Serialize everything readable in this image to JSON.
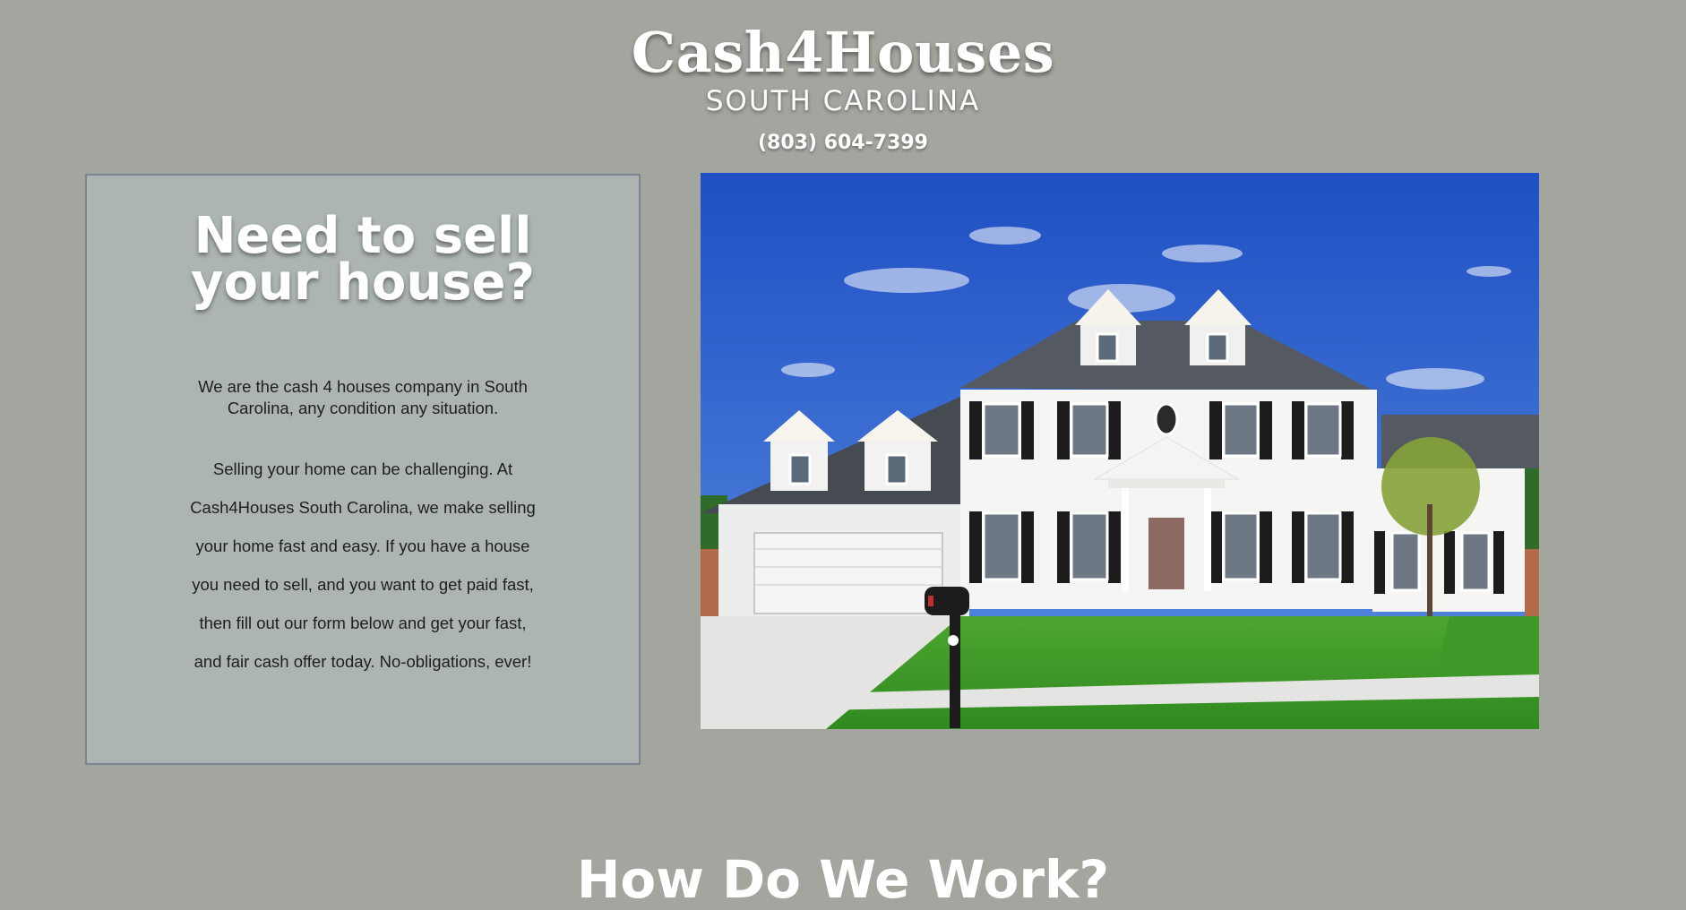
{
  "header": {
    "brand": "Cash4Houses",
    "region": "SOUTH CAROLINA",
    "phone": "(803) 604-7399"
  },
  "intro_panel": {
    "heading_line1": "Need to sell",
    "heading_line2": "your house?",
    "intro": "We are the cash 4 houses company in South Carolina, any condition any situation.",
    "body": "Selling your home can be challenging. At Cash4Houses South Carolina, we make selling your home fast and easy. If you have a house you need to sell, and you want to get paid fast, then fill out our form below and get your fast, and fair cash offer today. No-obligations, ever!"
  },
  "hero_image": {
    "alt": "white two-story colonial house with black shutters and green lawn"
  },
  "next_section": {
    "heading": "How Do We Work?"
  },
  "colors": {
    "page_background": "#a2a69e",
    "panel_background": "#adb5b2",
    "panel_border": "#7b8493",
    "text_light": "#ffffff",
    "text_dark": "#1f1f1f"
  }
}
